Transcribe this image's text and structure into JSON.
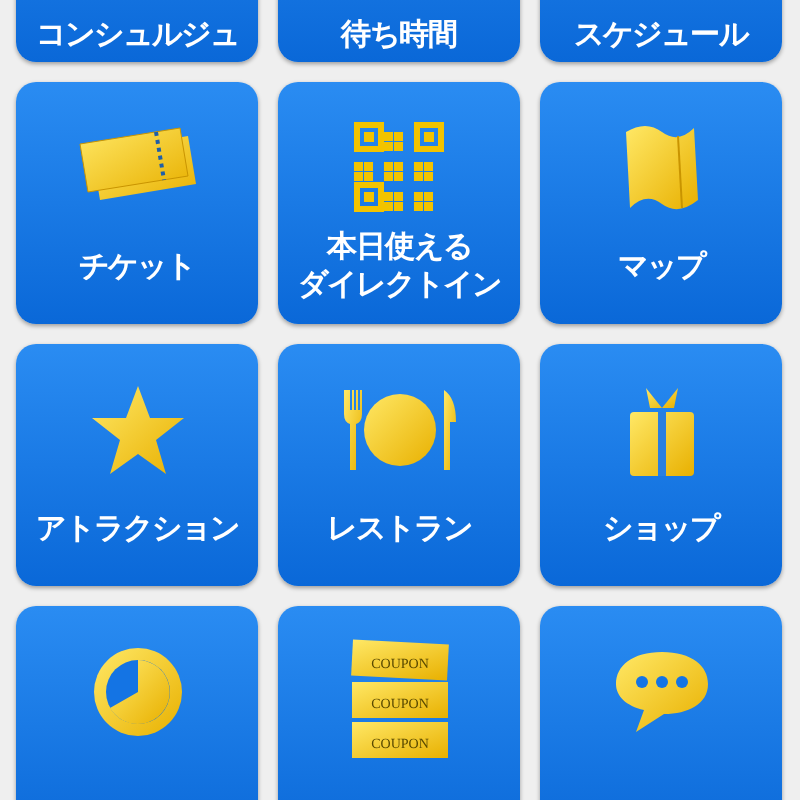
{
  "tiles": [
    {
      "lines": [
        "コンシュルジュ"
      ]
    },
    {
      "lines": [
        "待ち時間"
      ]
    },
    {
      "lines": [
        "スケジュール"
      ]
    },
    {
      "lines": [
        "チケット"
      ],
      "kind": "ticket"
    },
    {
      "lines": [
        "本日使える",
        "ダイレクトイン"
      ],
      "kind": "qr"
    },
    {
      "lines": [
        "マップ"
      ],
      "kind": "map"
    },
    {
      "lines": [
        "アトラクション"
      ],
      "kind": "star"
    },
    {
      "lines": [
        "レストラン"
      ],
      "kind": "dining"
    },
    {
      "lines": [
        "ショップ"
      ],
      "kind": "gift"
    },
    {
      "kind": "clock"
    },
    {
      "kind": "coupon",
      "icon_texts": [
        "COUPON",
        "COUPON",
        "COUPON"
      ]
    },
    {
      "kind": "chat"
    }
  ]
}
